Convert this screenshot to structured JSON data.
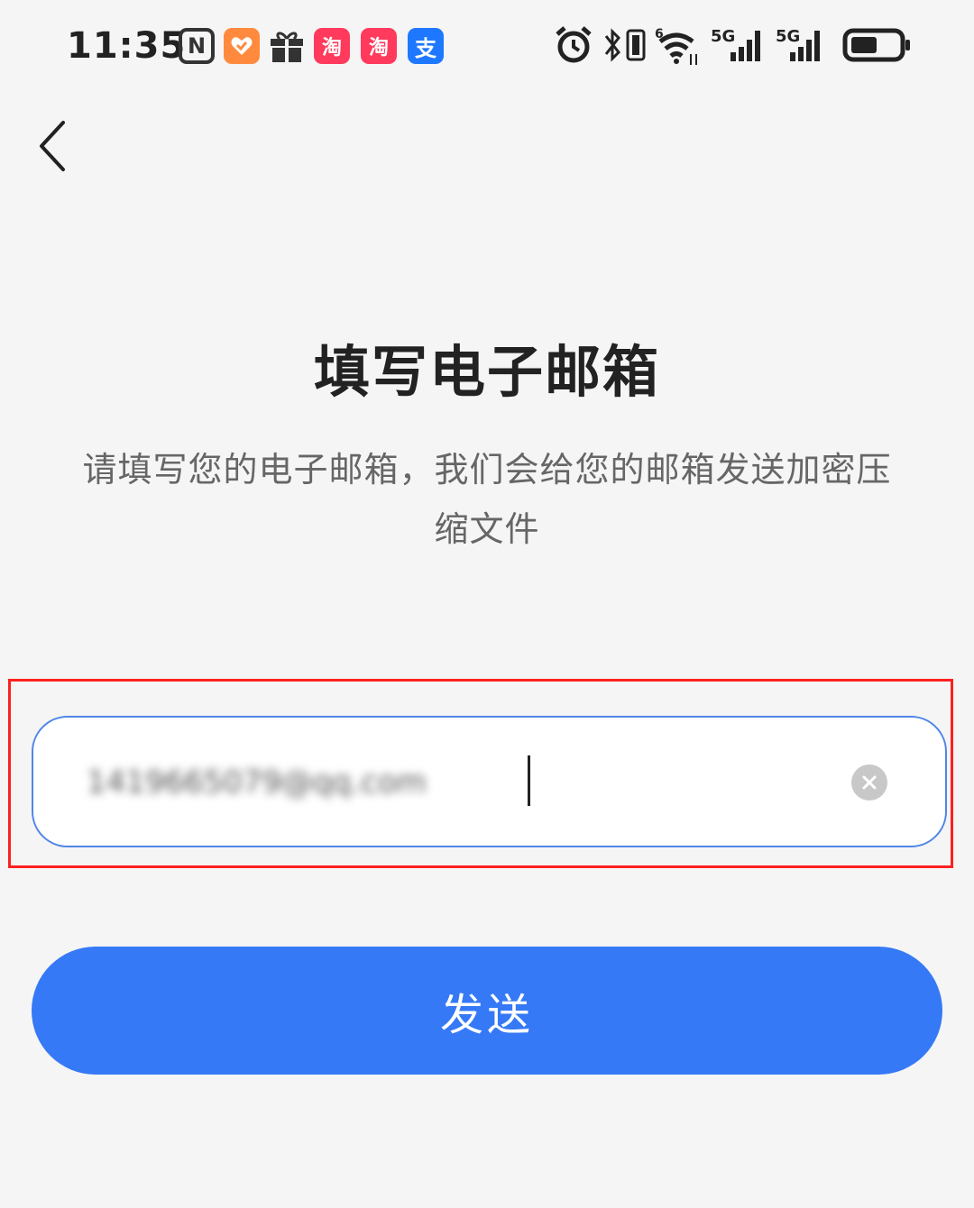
{
  "status_bar": {
    "time": "11:35",
    "nfc_label": "N",
    "taobao_label": "淘",
    "alipay_label": "支",
    "signal_label": "5G",
    "wifi_label": "6"
  },
  "header": {
    "back_icon": "chevron-left-icon"
  },
  "main": {
    "title": "填写电子邮箱",
    "description": "请填写您的电子邮箱，我们会给您的邮箱发送加密压缩文件"
  },
  "email_input": {
    "value": "1419665079@qq.com",
    "clear_icon": "close-circle-icon"
  },
  "actions": {
    "send_label": "发送"
  },
  "colors": {
    "primary": "#3579f6",
    "background": "#f5f5f5",
    "highlight": "#ff2020"
  }
}
